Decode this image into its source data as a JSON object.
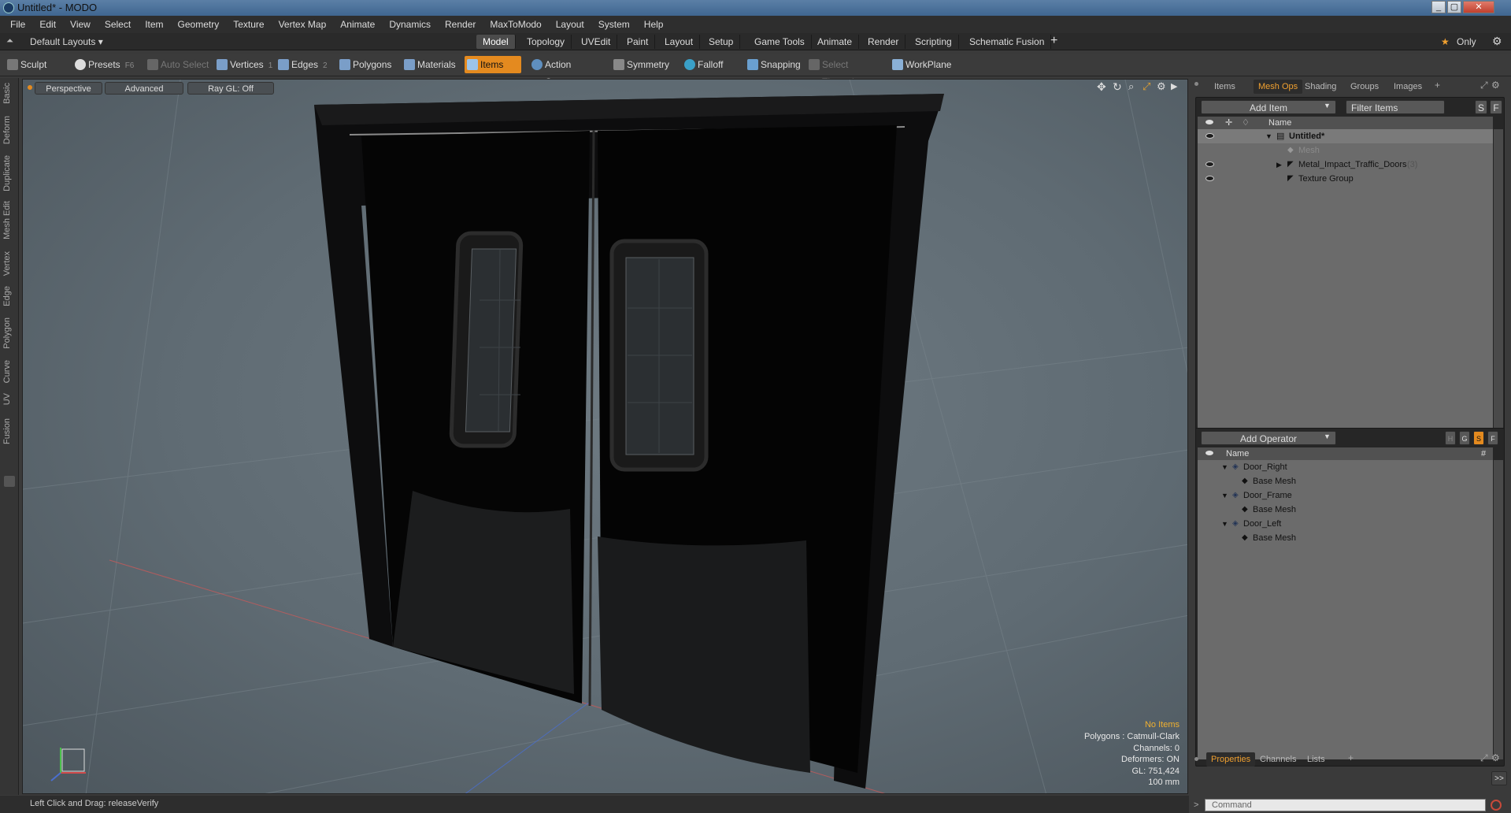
{
  "window": {
    "title": "Untitled* - MODO",
    "controls": [
      "_",
      "▢",
      "✕"
    ]
  },
  "menu": [
    "File",
    "Edit",
    "View",
    "Select",
    "Item",
    "Geometry",
    "Texture",
    "Vertex Map",
    "Animate",
    "Dynamics",
    "Render",
    "MaxToModo",
    "Layout",
    "System",
    "Help"
  ],
  "layout_bar": {
    "layout_name": "Default Layouts ▾",
    "tabs": [
      "Model",
      "Topology",
      "UVEdit",
      "Paint",
      "Layout",
      "Setup",
      "Game Tools",
      "Animate",
      "Render",
      "Scripting",
      "Schematic Fusion"
    ],
    "active_tab": "Model",
    "add": "+",
    "only": "Only"
  },
  "toolbar": {
    "sculpt": "Sculpt",
    "presets": "Presets",
    "presets_key": "F6",
    "auto_select": "Auto Select",
    "vertices": "Vertices",
    "vertices_key": "1",
    "edges": "Edges",
    "edges_key": "2",
    "polygons": "Polygons",
    "materials": "Materials",
    "items": "Items",
    "action_center": "Action Center",
    "symmetry": "Symmetry",
    "falloff": "Falloff",
    "snapping": "Snapping",
    "select_through": "Select Through",
    "workplane": "WorkPlane"
  },
  "left_tabs": [
    "Basic",
    "Deform",
    "Duplicate",
    "Mesh Edit",
    "Vertex",
    "Edge",
    "Polygon",
    "Curve",
    "UV",
    "Fusion"
  ],
  "viewport": {
    "perspective": "Perspective",
    "advanced": "Advanced",
    "raygl": "Ray GL: Off",
    "info": {
      "selection": "No Items",
      "polygons": "Polygons : Catmull-Clark",
      "channels": "Channels: 0",
      "deformers": "Deformers: ON",
      "gl": "GL: 751,424",
      "scale": "100 mm"
    },
    "colors": {
      "selection": "#f0b030"
    }
  },
  "items_panel": {
    "tabs": [
      "Items",
      "Mesh Ops",
      "Shading",
      "Groups",
      "Images"
    ],
    "active_tab": "Mesh Ops",
    "add_item": "Add Item",
    "filter": "Filter Items",
    "s": "S",
    "f": "F",
    "col_name": "Name",
    "rows": [
      {
        "label": "Untitled*"
      },
      {
        "label": "Mesh"
      },
      {
        "label": "Metal_Impact_Traffic_Doors",
        "count": "(3)"
      },
      {
        "label": "Texture Group"
      }
    ]
  },
  "operator_panel": {
    "add_operator": "Add Operator",
    "h": "H",
    "g": "G",
    "s": "S",
    "f": "F",
    "col_name": "Name",
    "col_hash": "#",
    "rows": [
      {
        "label": "Door_Right"
      },
      {
        "label": "Base Mesh"
      },
      {
        "label": "Door_Frame"
      },
      {
        "label": "Base Mesh"
      },
      {
        "label": "Door_Left"
      },
      {
        "label": "Base Mesh"
      }
    ]
  },
  "bottom_panel": {
    "tabs": [
      "Properties",
      "Channels",
      "Lists"
    ],
    "active_tab": "Properties",
    "expand": ">>"
  },
  "status": {
    "text": "Left Click and Drag:  releaseVerify"
  },
  "command": {
    "placeholder": "Command"
  }
}
